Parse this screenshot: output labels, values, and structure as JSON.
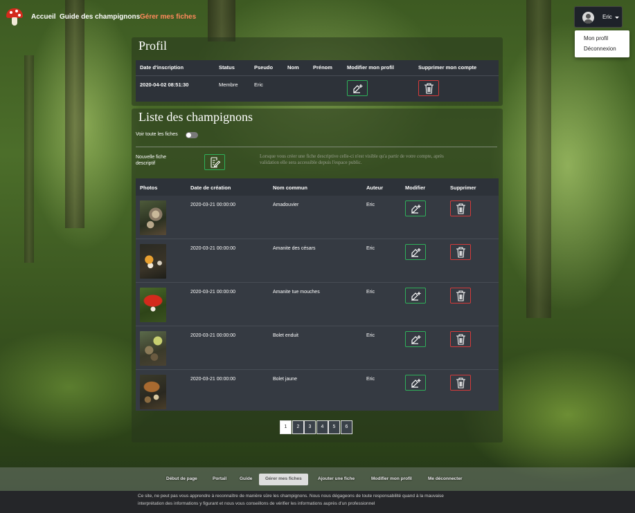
{
  "nav": {
    "links": [
      "Accueil",
      "Guide des champignons",
      "Gérer mes fiches"
    ],
    "user_name": "Eric",
    "dropdown": [
      "Mon profil",
      "Déconnexion"
    ]
  },
  "profile": {
    "title": "Profil",
    "headers": [
      "Date d'inscription",
      "Status",
      "Pseudo",
      "Nom",
      "Prénom",
      "Modifier mon profil",
      "Supprimer mon compte"
    ],
    "row": {
      "date": "2020-04-02 08:51:30",
      "status": "Membre",
      "pseudo": "Eric",
      "nom": "",
      "prenom": ""
    }
  },
  "list": {
    "title": "Liste des champignons",
    "toggle_label": "Voir toute les fiches",
    "new_label_1": "Nouvelle fiche",
    "new_label_2": "descriptif",
    "info_line_1": "Lorsque vous créer une fiche descriptive celle-ci n'est visible qu'a partir de votre compte, après",
    "info_line_2": "validation elle sera accessible depuis l'espace public.",
    "headers": [
      "Photos",
      "Date de création",
      "Nom commun",
      "Auteur",
      "Modifier",
      "Supprimer"
    ],
    "rows": [
      {
        "date": "2020-03-21 00:00:00",
        "name": "Amadouvier",
        "author": "Eric"
      },
      {
        "date": "2020-03-21 00:00:00",
        "name": "Amanite des césars",
        "author": "Eric"
      },
      {
        "date": "2020-03-21 00:00:00",
        "name": "Amanite tue mouches",
        "author": "Eric"
      },
      {
        "date": "2020-03-21 00:00:00",
        "name": "Bolet enduit",
        "author": "Eric"
      },
      {
        "date": "2020-03-21 00:00:00",
        "name": "Bolet jaune",
        "author": "Eric"
      }
    ]
  },
  "pagination": {
    "pages": [
      "1",
      "2",
      "3",
      "4",
      "5",
      "6"
    ],
    "active": "1"
  },
  "footer": {
    "links": [
      "Début de page",
      "Portail",
      "Guide",
      "Gérer mes fiches",
      "Ajouter une fiche",
      "Modifier mon profil",
      "Me déconnecter"
    ],
    "active": "Gérer mes fiches",
    "disclaimer_1": "Ce site, ne peut pas vous apprendre à reconnaître de manière sûre les champignons. Nous nous dégageons de toute responsabilité quand à la mauvaise",
    "disclaimer_2": "interprétation des informations y figurant et nous vous conseillons de vérifier les informations auprès d'un professionnel"
  },
  "colors": {
    "edit_border": "#2fb15a",
    "delete_border": "#d73a3a",
    "active_nav": "#ff8a5c"
  },
  "icons": [
    "mushroom-logo-icon",
    "user-avatar-icon",
    "edit-pen-plus-icon",
    "trash-icon",
    "new-document-icon"
  ]
}
